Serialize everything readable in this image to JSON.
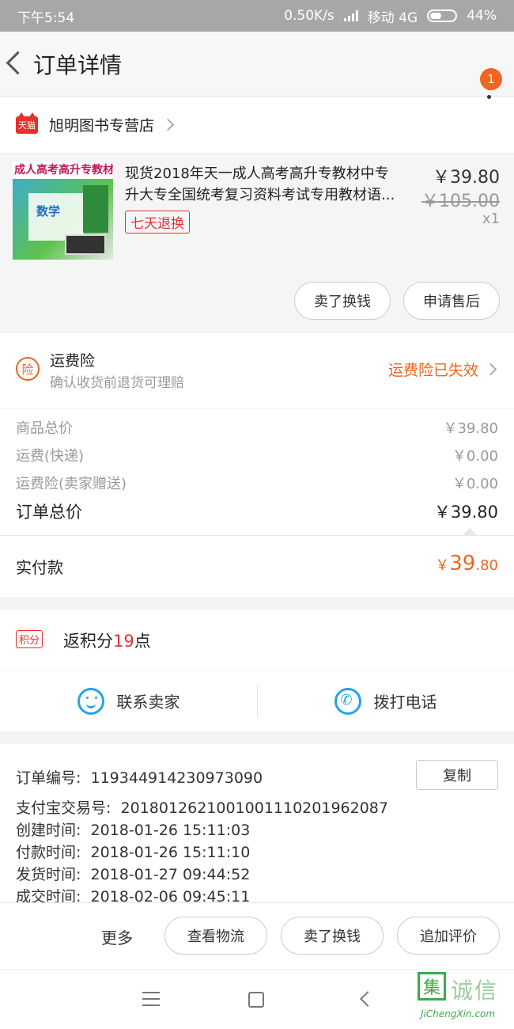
{
  "status_bar": {
    "time": "下午5:54",
    "speed": "0.50K/s",
    "network": "移动 4G",
    "battery": "44%"
  },
  "header": {
    "title": "订单详情",
    "badge_count": "1"
  },
  "store": {
    "platform_tag": "天猫",
    "name": "旭明图书专营店"
  },
  "product": {
    "thumb_title": "成人高考高升专教材",
    "thumb_subject": "数学",
    "name_line1": "现货2018年天一成人高考高升专教材中专",
    "name_line2": "升大专全国统考复习资料考试专用教材语...",
    "return_tag": "七天退换",
    "price": "￥39.80",
    "original_price": "￥105.00",
    "quantity": "x1",
    "buttons": [
      "卖了换钱",
      "申请售后"
    ]
  },
  "insurance": {
    "icon_text": "险",
    "title": "运费险",
    "subtitle": "确认收货前退货可理赔",
    "status": "运费险已失效"
  },
  "costs": [
    {
      "label": "商品总价",
      "value": "￥39.80"
    },
    {
      "label": "运费(快递)",
      "value": "￥0.00"
    },
    {
      "label": "运费险(卖家赠送)",
      "value": "￥0.00"
    },
    {
      "label": "订单总价",
      "value": "￥39.80"
    }
  ],
  "paid": {
    "label": "实付款",
    "currency": "￥",
    "integer": "39",
    "decimal": ".80"
  },
  "points": {
    "icon_text": "积分",
    "prefix": "返积分",
    "amount": "19",
    "suffix": "点"
  },
  "contact": {
    "seller": "联系卖家",
    "phone": "拨打电话"
  },
  "order_info": {
    "copy_label": "复制",
    "rows": [
      {
        "label": "订单编号:",
        "value": "119344914230973090"
      },
      {
        "label": "支付宝交易号:",
        "value": "2018012621001001110201962087"
      },
      {
        "label": "创建时间:",
        "value": "2018-01-26 15:11:03"
      },
      {
        "label": "付款时间:",
        "value": "2018-01-26 15:11:10"
      },
      {
        "label": "发货时间:",
        "value": "2018-01-27 09:44:52"
      },
      {
        "label": "成交时间:",
        "value": "2018-02-06 09:45:11"
      }
    ]
  },
  "actions": {
    "more": "更多",
    "buttons": [
      "查看物流",
      "卖了换钱",
      "追加评价"
    ]
  },
  "watermark": {
    "glyph": "集",
    "text": "诚信",
    "url": "JiChengXin.com"
  },
  "colors": {
    "accent": "#f26422",
    "tmall_red": "#e4312d",
    "icon_blue": "#26a3e6"
  }
}
